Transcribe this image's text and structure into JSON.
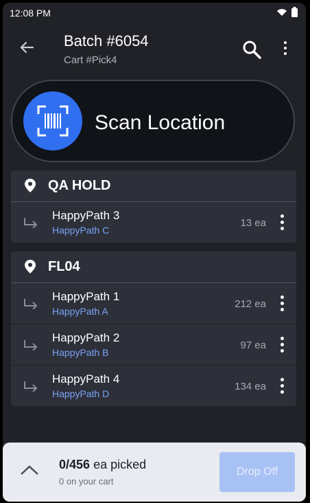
{
  "status_bar": {
    "time": "12:08 PM"
  },
  "header": {
    "title": "Batch #6054",
    "subtitle": "Cart #Pick4"
  },
  "scan": {
    "label": "Scan Location"
  },
  "groups": [
    {
      "location": "QA HOLD",
      "items": [
        {
          "name": "HappyPath 3",
          "sub": "HappyPath C",
          "qty": "13 ea"
        }
      ]
    },
    {
      "location": "FL04",
      "items": [
        {
          "name": "HappyPath 1",
          "sub": "HappyPath A",
          "qty": "212 ea"
        },
        {
          "name": "HappyPath 2",
          "sub": "HappyPath B",
          "qty": "97 ea"
        },
        {
          "name": "HappyPath 4",
          "sub": "HappyPath D",
          "qty": "134 ea"
        }
      ]
    }
  ],
  "footer": {
    "picked_count": "0/456",
    "picked_unit": "ea picked",
    "cart_note": "0 on your cart",
    "drop_label": "Drop Off"
  },
  "colors": {
    "accent": "#2f6ff0",
    "link": "#7aa2f5",
    "background": "#202227"
  }
}
